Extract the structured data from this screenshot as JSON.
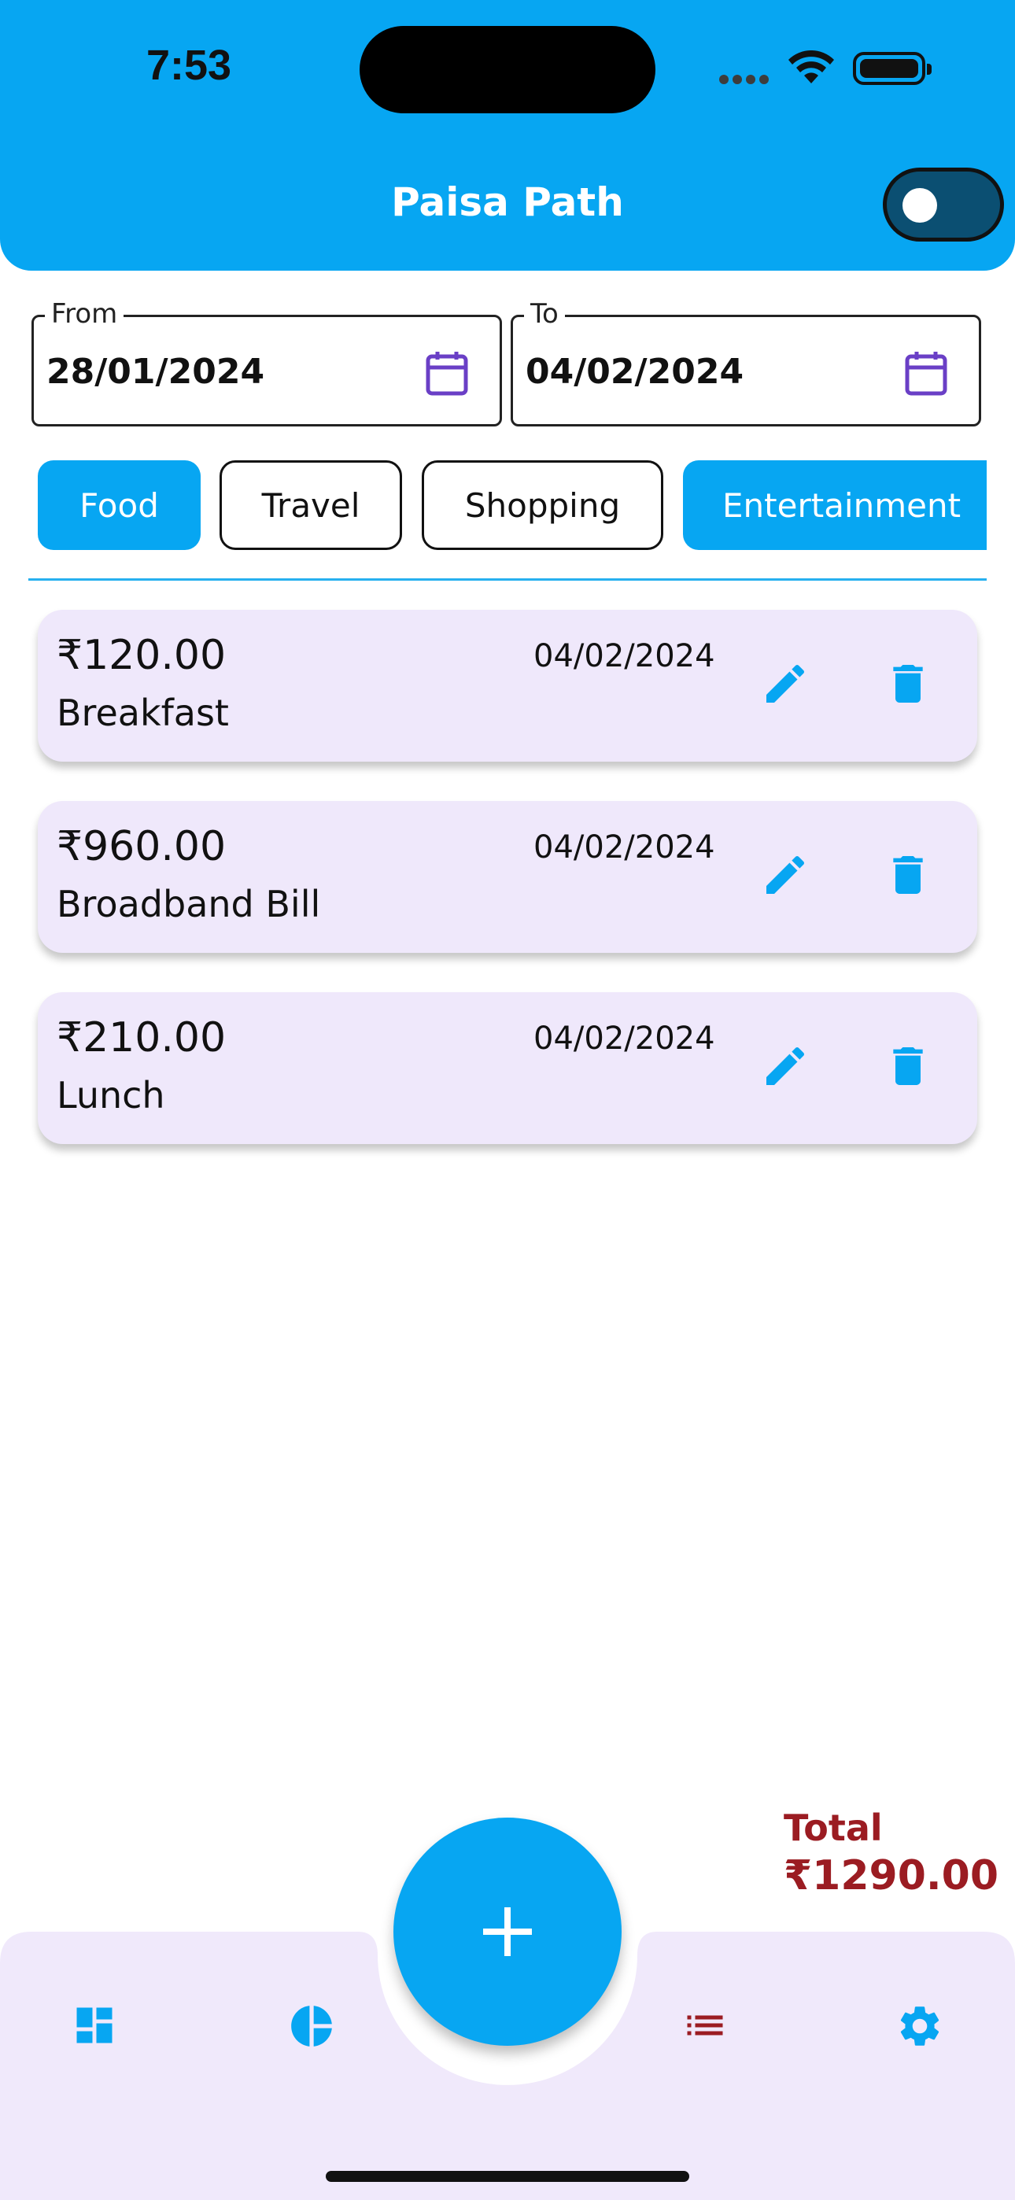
{
  "status_bar": {
    "time": "7:53"
  },
  "header": {
    "title": "Paisa Path",
    "theme_toggle_on": false
  },
  "date_range": {
    "from_label": "From",
    "from_value": "28/01/2024",
    "to_label": "To",
    "to_value": "04/02/2024"
  },
  "categories": [
    {
      "label": "Food",
      "selected": true
    },
    {
      "label": "Travel",
      "selected": false
    },
    {
      "label": "Shopping",
      "selected": false
    },
    {
      "label": "Entertainment",
      "selected": true
    }
  ],
  "expenses": [
    {
      "amount": "₹120.00",
      "description": "Breakfast",
      "date": "04/02/2024"
    },
    {
      "amount": "₹960.00",
      "description": "Broadband Bill",
      "date": "04/02/2024"
    },
    {
      "amount": "₹210.00",
      "description": "Lunch",
      "date": "04/02/2024"
    }
  ],
  "total": {
    "label": "Total",
    "value": "₹1290.00"
  },
  "colors": {
    "primary": "#07a6f2",
    "card": "#efe8fb",
    "nav_background": "#f0e9fb",
    "total_text": "#9b1c22",
    "calendar_icon": "#6a3fc6",
    "active_nav_icon": "#9b1c22"
  },
  "nav": {
    "items": [
      {
        "icon": "dashboard-icon",
        "active": false
      },
      {
        "icon": "pie-chart-icon",
        "active": false
      },
      {
        "icon": "add-icon",
        "active": false
      },
      {
        "icon": "list-icon",
        "active": true
      },
      {
        "icon": "settings-icon",
        "active": false
      }
    ]
  }
}
